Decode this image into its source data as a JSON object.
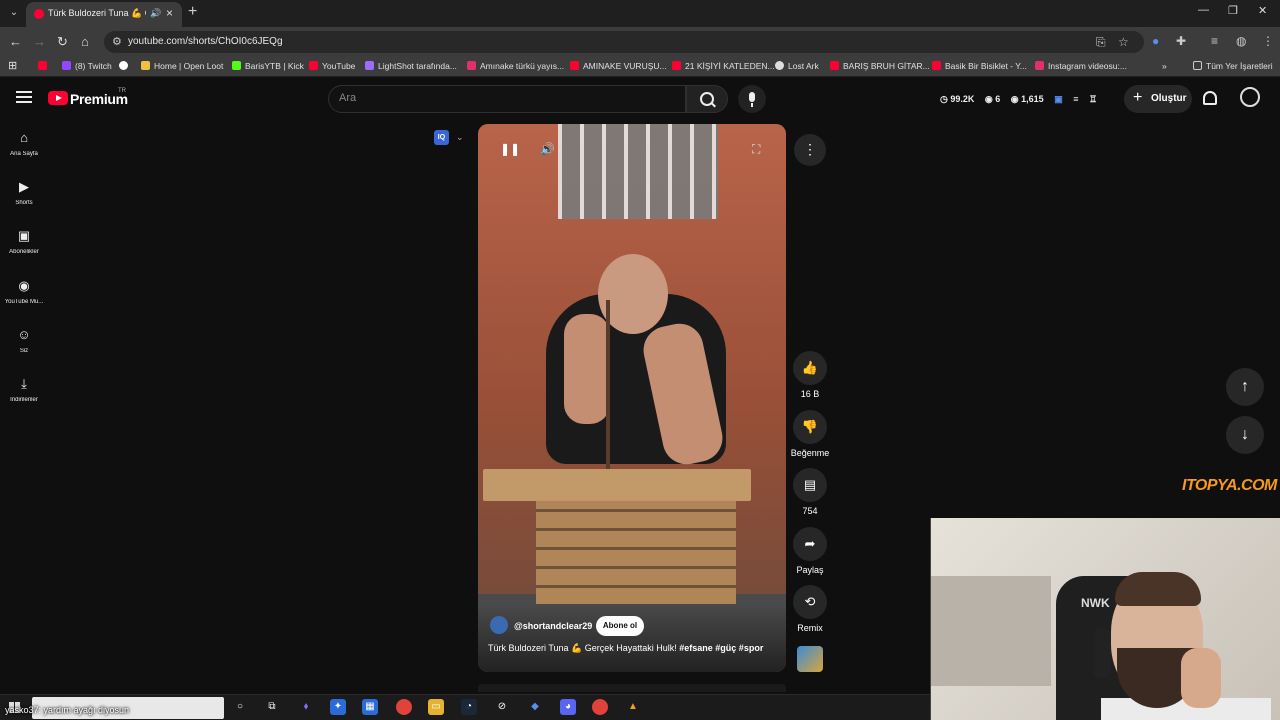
{
  "browser": {
    "tab_title": "Türk Buldozeri Tuna 💪 Gerçek Hayattaki Hulk! #efsane #güç #spor",
    "url": "youtube.com/shorts/ChOI0c6JEQg",
    "window_controls": [
      "—",
      "❐",
      "✕"
    ]
  },
  "bookmarks": [
    {
      "label": "",
      "color": "#ff0033"
    },
    {
      "label": "(8) Twitch",
      "color": "#9146ff"
    },
    {
      "label": "",
      "color": "#ffffff"
    },
    {
      "label": "Home | Open Loot",
      "color": "#f0c040"
    },
    {
      "label": "BarisYTB | Kick",
      "color": "#53fc18"
    },
    {
      "label": "YouTube",
      "color": "#ff0033"
    },
    {
      "label": "LightShot tarafında...",
      "color": "#9b6cff"
    },
    {
      "label": "Amınake türkü yayıs...",
      "color": "#e1306c"
    },
    {
      "label": "AMINAKE VURUŞU...",
      "color": "#ff0033"
    },
    {
      "label": "21 KİŞİYİ KATLEDEN...",
      "color": "#ff0033"
    },
    {
      "label": "Lost Ark",
      "color": "#dddddd"
    },
    {
      "label": "BARIŞ BRUH GİTAR...",
      "color": "#ff0033"
    },
    {
      "label": "Basik Bir Bisiklet - Y...",
      "color": "#ff0033"
    },
    {
      "label": "Instagram videosu:...",
      "color": "#e1306c"
    }
  ],
  "bookmarks_more": "»",
  "bookmarks_all": "Tüm Yer İşaretleri",
  "header": {
    "brand": "Premium",
    "region": "TR",
    "search_placeholder": "Ara",
    "stats": [
      "99.2K",
      "6",
      "1,615"
    ],
    "create_label": "Oluştur"
  },
  "sidebar": {
    "items": [
      {
        "label": "Ana Sayfa",
        "icon": "⌂"
      },
      {
        "label": "Shorts",
        "icon": "▶"
      },
      {
        "label": "Abonelikler",
        "icon": "▣"
      },
      {
        "label": "YouTube Mu...",
        "icon": "◉"
      },
      {
        "label": "Siz",
        "icon": "☺"
      },
      {
        "label": "İndirilenler",
        "icon": "⤓"
      }
    ]
  },
  "video": {
    "channel": "@shortandclear29",
    "subscribe_label": "Abone ol",
    "title_plain": "Türk Buldozeri Tuna 💪 Gerçek Hayattaki Hulk! ",
    "title_tags": "#efsane #güç #spor",
    "iq_badge": "IQ"
  },
  "actions": {
    "like_count": "16 B",
    "dislike_label": "Beğenme",
    "comment_count": "754",
    "share_label": "Paylaş",
    "remix_label": "Remix"
  },
  "watermark": "ITOPYA.COM",
  "webcam": {
    "chair_text": "NWK"
  },
  "taskbar": {
    "caption": "yasko37: yardım ayağı diyosun"
  }
}
